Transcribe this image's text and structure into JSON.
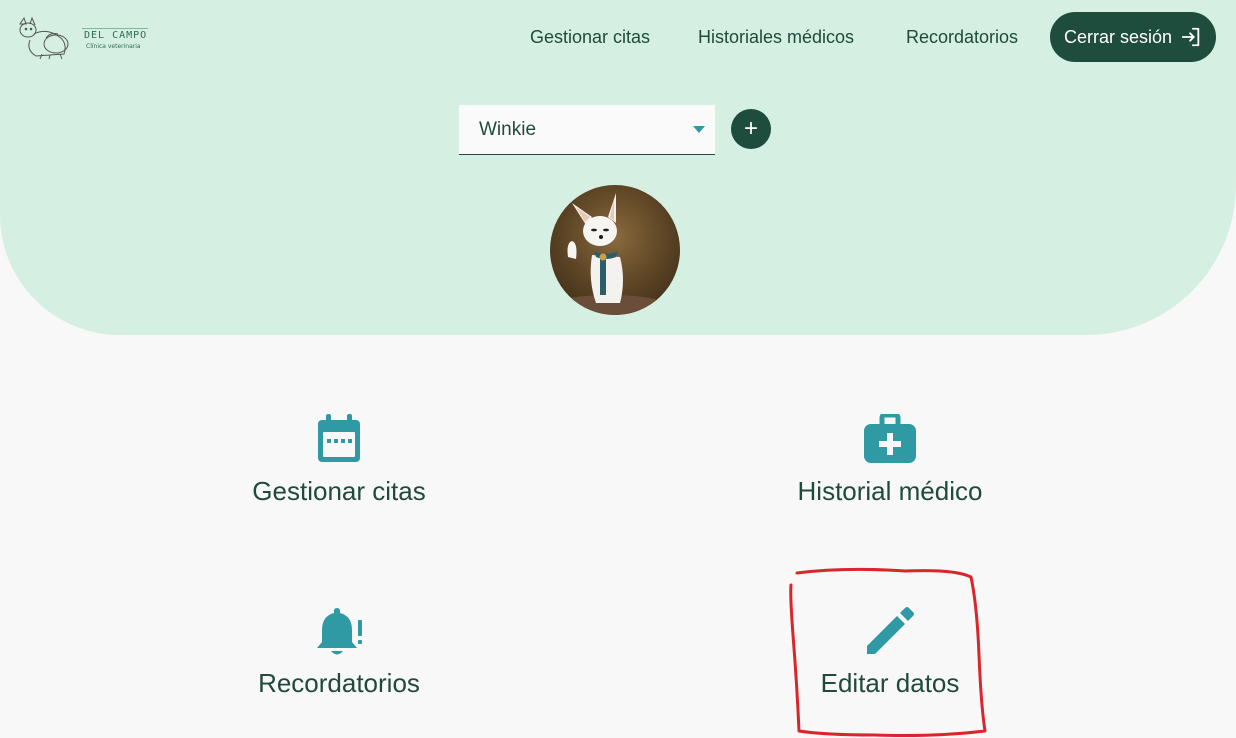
{
  "header": {
    "logo": {
      "name": "DEL CAMPO",
      "tagline": "Clínica veterinaria",
      "icon": "pets-line-art-logo"
    },
    "nav": [
      {
        "label": "Gestionar citas"
      },
      {
        "label": "Historiales médicos"
      },
      {
        "label": "Recordatorios"
      }
    ],
    "logout": {
      "label": "Cerrar sesión",
      "icon": "logout-arrow-icon"
    }
  },
  "pet_selector": {
    "selected": "Winkie",
    "add_button_label": "+"
  },
  "tiles": [
    {
      "label": "Gestionar citas",
      "icon": "calendar-icon"
    },
    {
      "label": "Historial médico",
      "icon": "medical-kit-icon"
    },
    {
      "label": "Recordatorios",
      "icon": "bell-alert-icon"
    },
    {
      "label": "Editar datos",
      "icon": "pencil-icon"
    }
  ],
  "colors": {
    "hero_bg": "#d5efe3",
    "primary_dark": "#1e4d3e",
    "accent_teal": "#2f9aa3",
    "page_bg": "#f8f8f8",
    "annotation_red": "#d9262b"
  }
}
